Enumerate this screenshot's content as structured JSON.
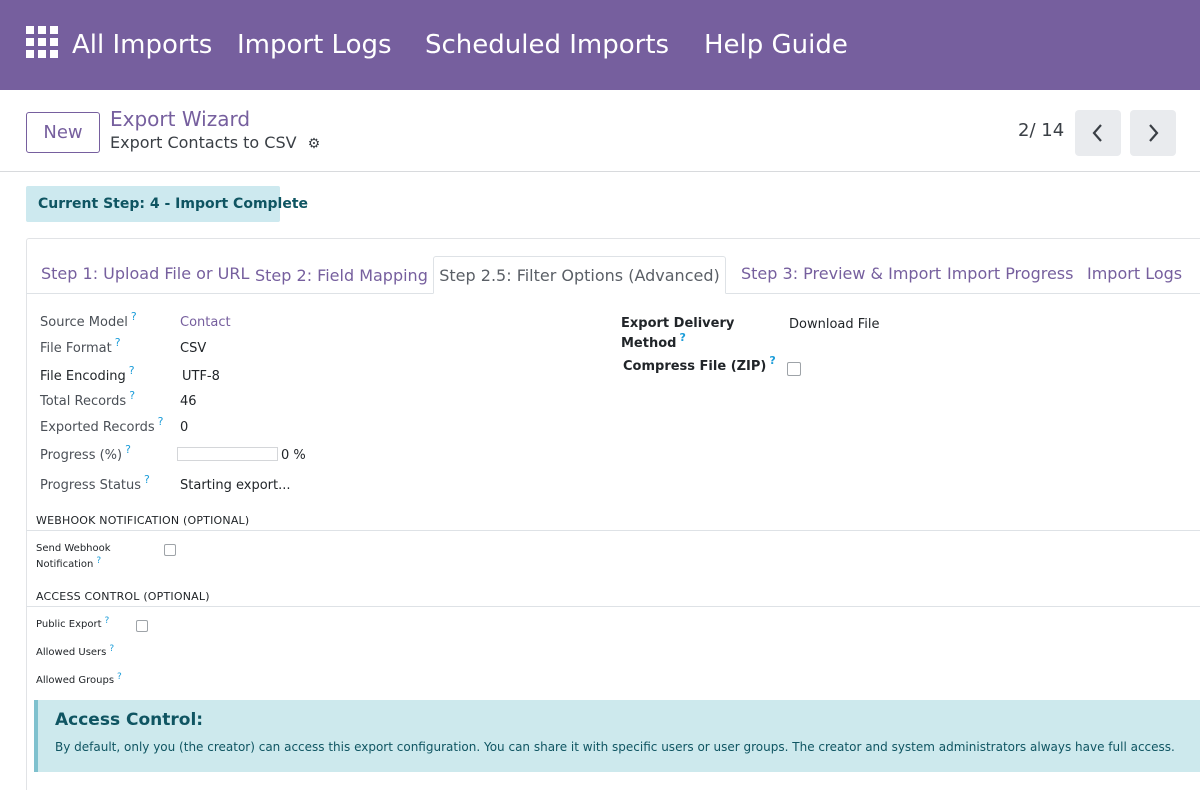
{
  "topnav": {
    "apps_icon": "apps-grid-icon",
    "items": [
      "All Imports",
      "Import Logs",
      "Scheduled Imports",
      "Help Guide"
    ]
  },
  "control_panel": {
    "new_label": "New",
    "breadcrumb_parent": "Export Wizard",
    "breadcrumb_current": "Export Contacts to CSV",
    "gear_icon": "gear-icon",
    "pager_value": "2/ 14",
    "prev_icon": "chevron-left-icon",
    "next_icon": "chevron-right-icon"
  },
  "step_badge": "Current Step: 4 - Import Complete",
  "tabs": {
    "items": [
      "Step 1: Upload File or URL",
      "Step 2: Field Mapping",
      "Step 2.5: Filter Options (Advanced)",
      "Step 3: Preview & Import",
      "Import Progress",
      "Import Logs"
    ],
    "active": "Step 2.5: Filter Options (Advanced)"
  },
  "help_mark": "?",
  "fields": {
    "source_model": {
      "label": "Source Model",
      "value": "Contact"
    },
    "file_format": {
      "label": "File Format",
      "value": "CSV"
    },
    "file_encoding": {
      "label": "File Encoding",
      "value": "UTF-8"
    },
    "total_records": {
      "label": "Total Records",
      "value": "46"
    },
    "exported_records": {
      "label": "Exported Records",
      "value": "0"
    },
    "progress": {
      "label": "Progress (%)",
      "value": "0 %",
      "fraction": 0
    },
    "progress_status": {
      "label": "Progress Status",
      "value": "Starting export..."
    },
    "delivery_method": {
      "label_line1": "Export Delivery",
      "label_line2": "Method",
      "value": "Download File"
    },
    "compress": {
      "label": "Compress File (ZIP)",
      "checked": false
    }
  },
  "webhook": {
    "title": "WEBHOOK NOTIFICATION (OPTIONAL)",
    "send_label_line1": "Send Webhook",
    "send_label_line2": "Notification",
    "checked": false
  },
  "access": {
    "title": "ACCESS CONTROL (OPTIONAL)",
    "public_label": "Public Export",
    "public_checked": false,
    "users_label": "Allowed Users",
    "groups_label": "Allowed Groups"
  },
  "alert": {
    "title": "Access Control:",
    "body": "By default, only you (the creator) can access this export configuration. You can share it with specific users or user groups. The creator and system administrators always have full access."
  }
}
